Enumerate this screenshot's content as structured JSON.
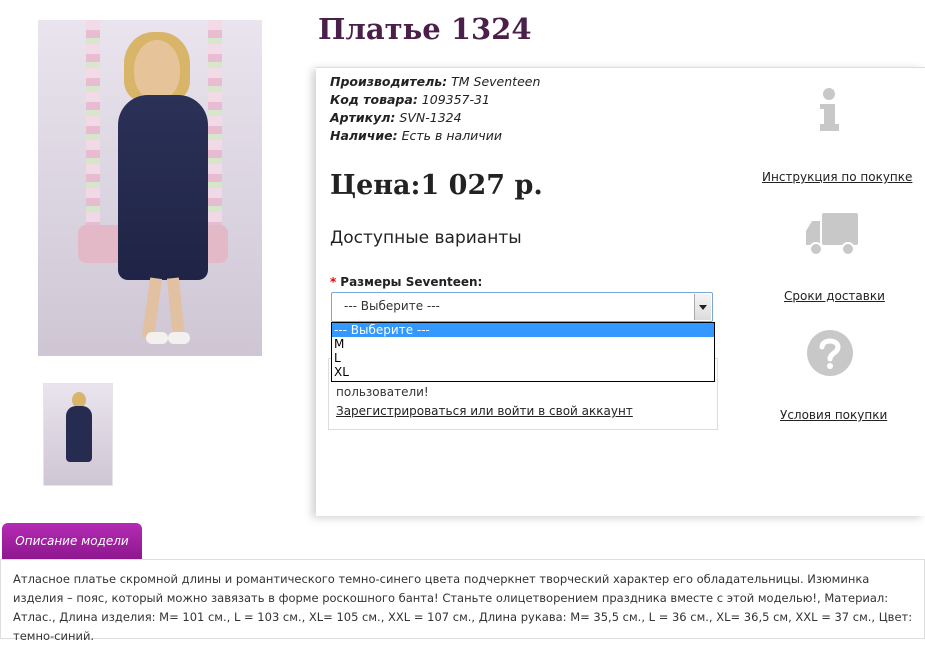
{
  "product": {
    "title": "Платье 1324",
    "manufacturer_label": "Производитель:",
    "manufacturer": "TM Seventeen",
    "code_label": "Код товара:",
    "code": "109357-31",
    "article_label": "Артикул:",
    "article": "SVN-1324",
    "availability_label": "Наличие:",
    "availability": "Есть в наличии",
    "price": "Цена:1 027 р.",
    "variants_title": "Доступные варианты",
    "size_required_mark": "*",
    "size_label": "Размеры Seventeen:"
  },
  "size_select": {
    "value": "--- Выберите ---",
    "options": [
      "--- Выберите ---",
      "M",
      "L",
      "XL"
    ],
    "selected_index": 0
  },
  "message_box": {
    "text": "пользователи!",
    "link": "Зарегистрироваться или войти в свой аккаунт"
  },
  "sidebar": {
    "instructions": "Инструкция по покупке",
    "delivery": "Сроки доставки",
    "terms": "Условия покупки"
  },
  "tabs": {
    "description": "Описание модели"
  },
  "description": "Атласное платье скромной длины и романтического темно-синего цвета подчеркнет творческий характер его обладательницы. Изюминка изделия – пояс, который можно завязать в форме роскошного банта! Станьте олицетворением праздника вместе с этой моделью!, Материал: Атлас., Длина изделия: M= 101 см., L = 103 см., XL= 105 см., XXL = 107 см., Длина рукава: M= 35,5 см., L = 36 см., XL= 36,5 см, XXL = 37 см., Цвет: темно-синий.",
  "colors": {
    "title": "#4a1f4a",
    "tab": "#a020a0",
    "dress": "#262b50"
  }
}
